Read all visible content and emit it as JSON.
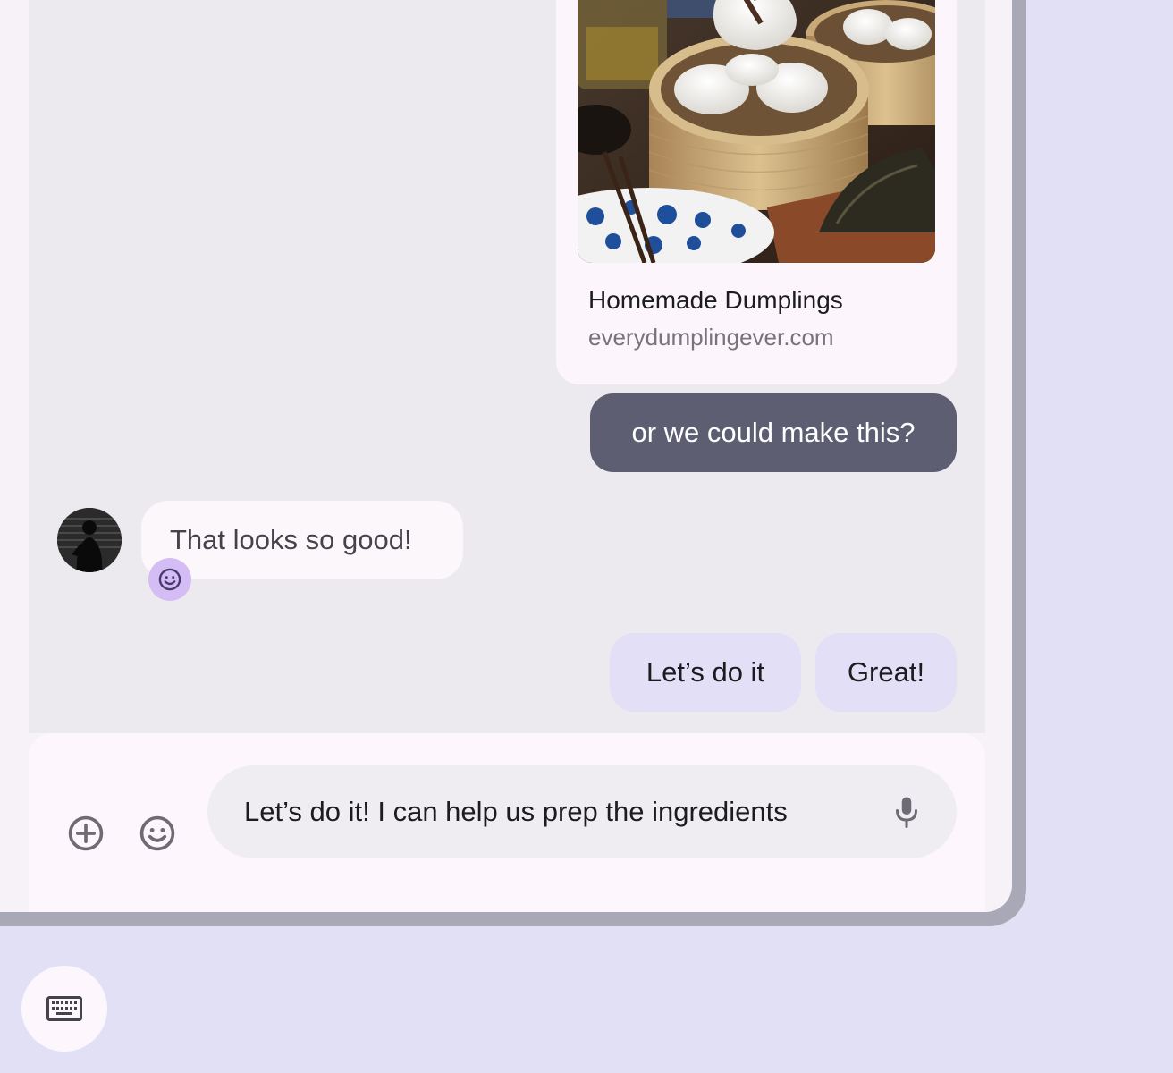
{
  "link_preview": {
    "title": "Homemade Dumplings",
    "url": "everydumplingever.com",
    "image_icon": "dumplings-photo"
  },
  "messages": {
    "sent": "or we could make this?",
    "received": "That looks so good!",
    "received_reaction_icon": "smiley-reaction-icon"
  },
  "suggestions": [
    {
      "label": "Let’s do it"
    },
    {
      "label": "Great!"
    }
  ],
  "compose": {
    "text": "Let’s do it! I can help us prep the ingredients",
    "add_icon": "add-circle-icon",
    "emoji_icon": "emoji-icon",
    "mic_icon": "mic-icon"
  },
  "system": {
    "keyboard_icon": "keyboard-icon"
  },
  "colors": {
    "background": "#e2e0f5",
    "chat_background": "#ece9ef",
    "sent_bubble": "#5d5e72",
    "suggestion_chip": "#e2dff6",
    "reaction": "#d4bdf5"
  }
}
